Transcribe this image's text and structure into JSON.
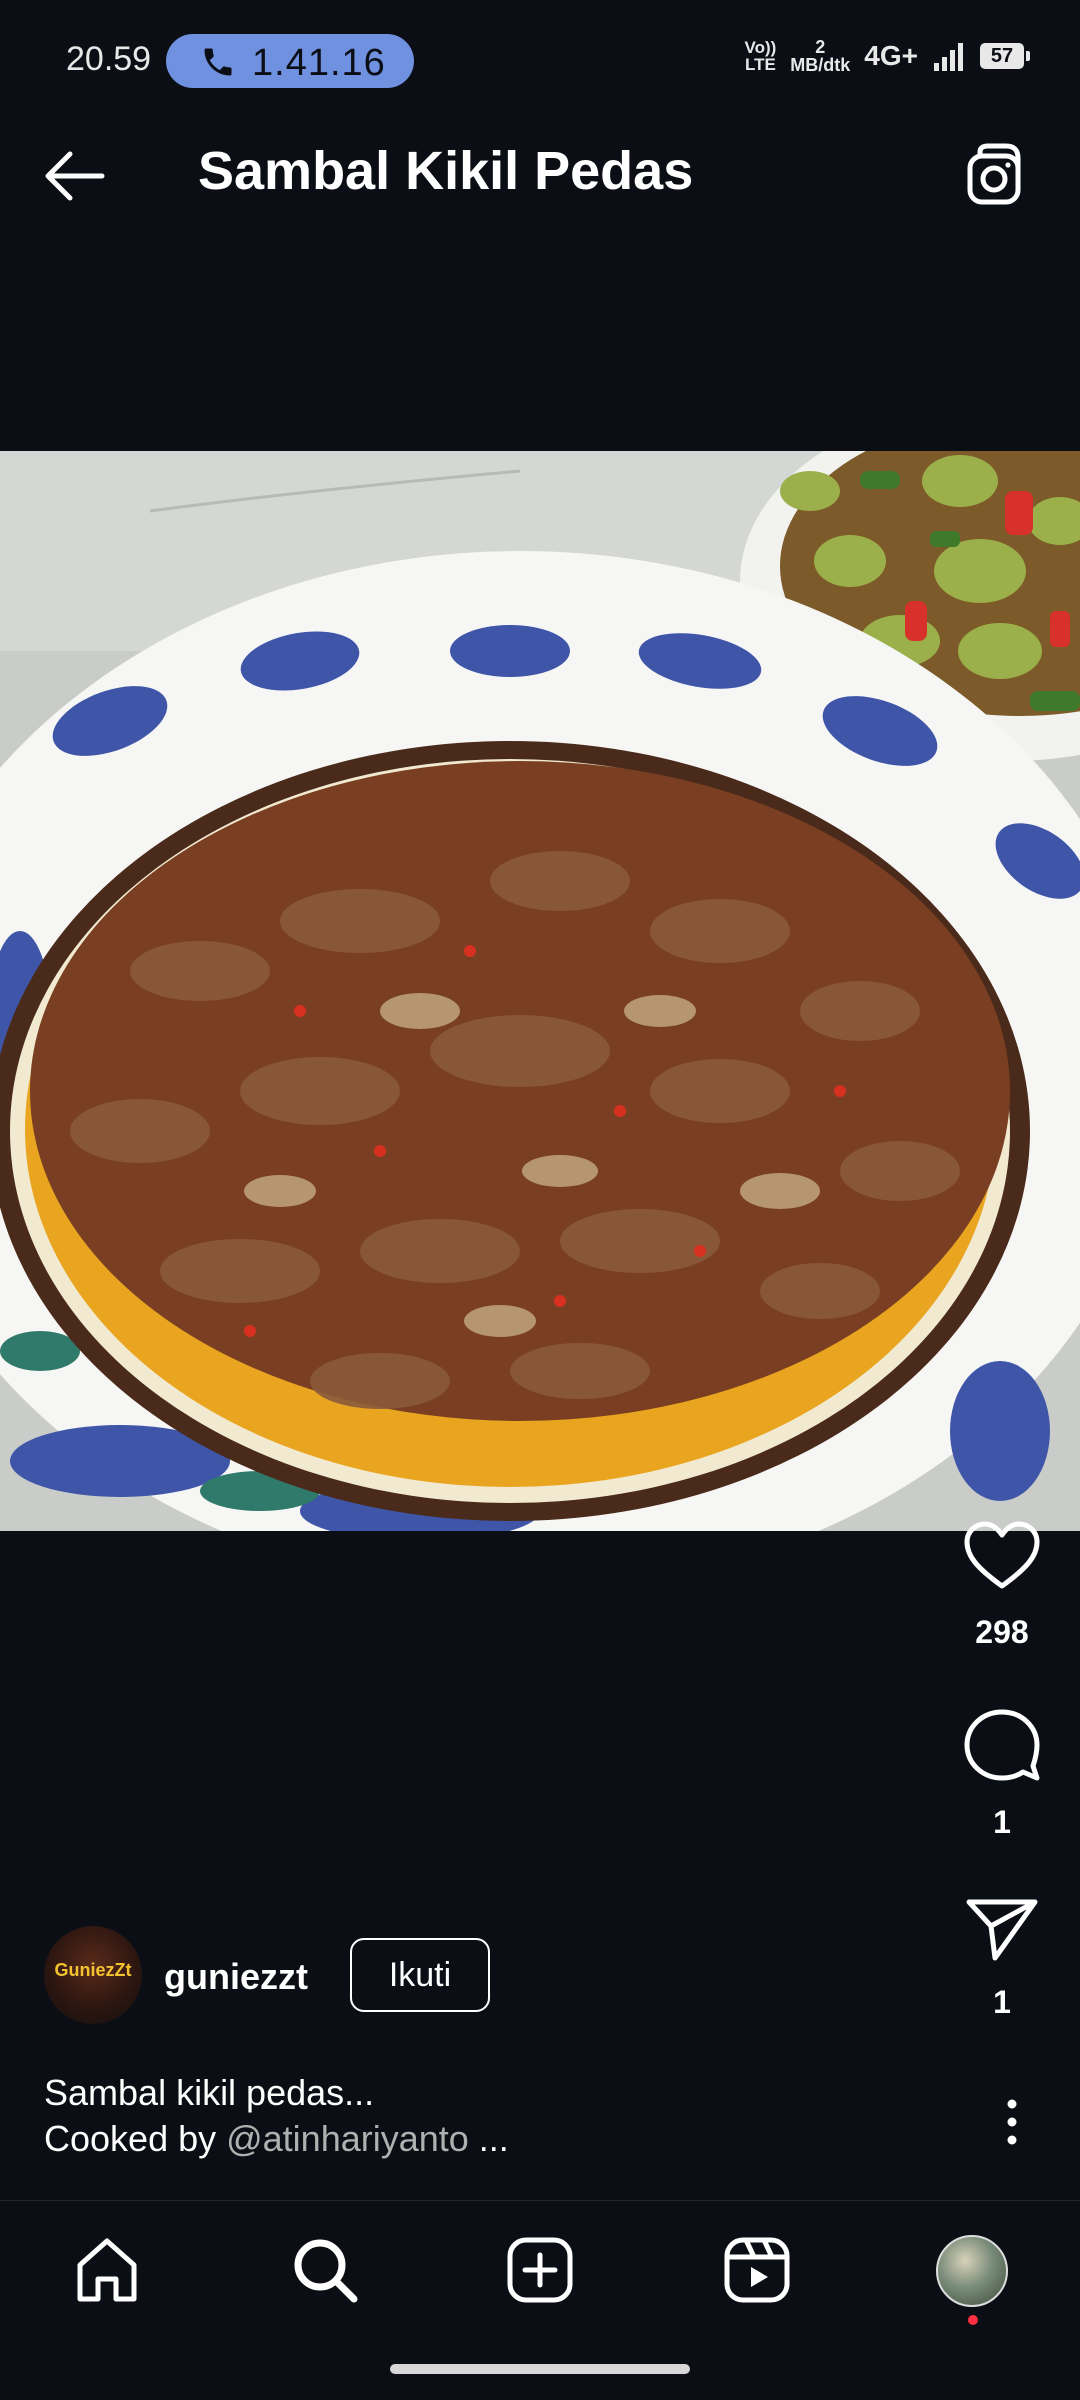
{
  "status_bar": {
    "time": "20.59",
    "call_duration": "1.41.16",
    "volte_label_top": "Vo))",
    "volte_label_bottom": "LTE",
    "net_speed_value": "2",
    "net_speed_unit": "MB/dtk",
    "network_type": "4G+",
    "battery_level": "57"
  },
  "header": {
    "title": "Sambal Kikil Pedas",
    "back_icon": "arrow-left-icon",
    "camera_icon": "camera-icon"
  },
  "post": {
    "image_alt": "Sambal kikil pedas dish on a plate",
    "likes": "298",
    "comments": "1",
    "shares": "1",
    "author": {
      "username": "guniezzt",
      "avatar_text": "GuniezZt",
      "follow_label": "Ikuti"
    },
    "caption_line1": "Sambal kikil pedas...",
    "caption_prefix": "Cooked by ",
    "caption_mention": "@atinhariyanto",
    "caption_more": " ..."
  },
  "bottom_nav": {
    "items": [
      "home-icon",
      "search-icon",
      "add-icon",
      "reels-icon",
      "profile-avatar"
    ]
  },
  "colors": {
    "background": "#0b0f15",
    "call_pill": "#6f91e0",
    "notification_dot": "#ff3040"
  }
}
